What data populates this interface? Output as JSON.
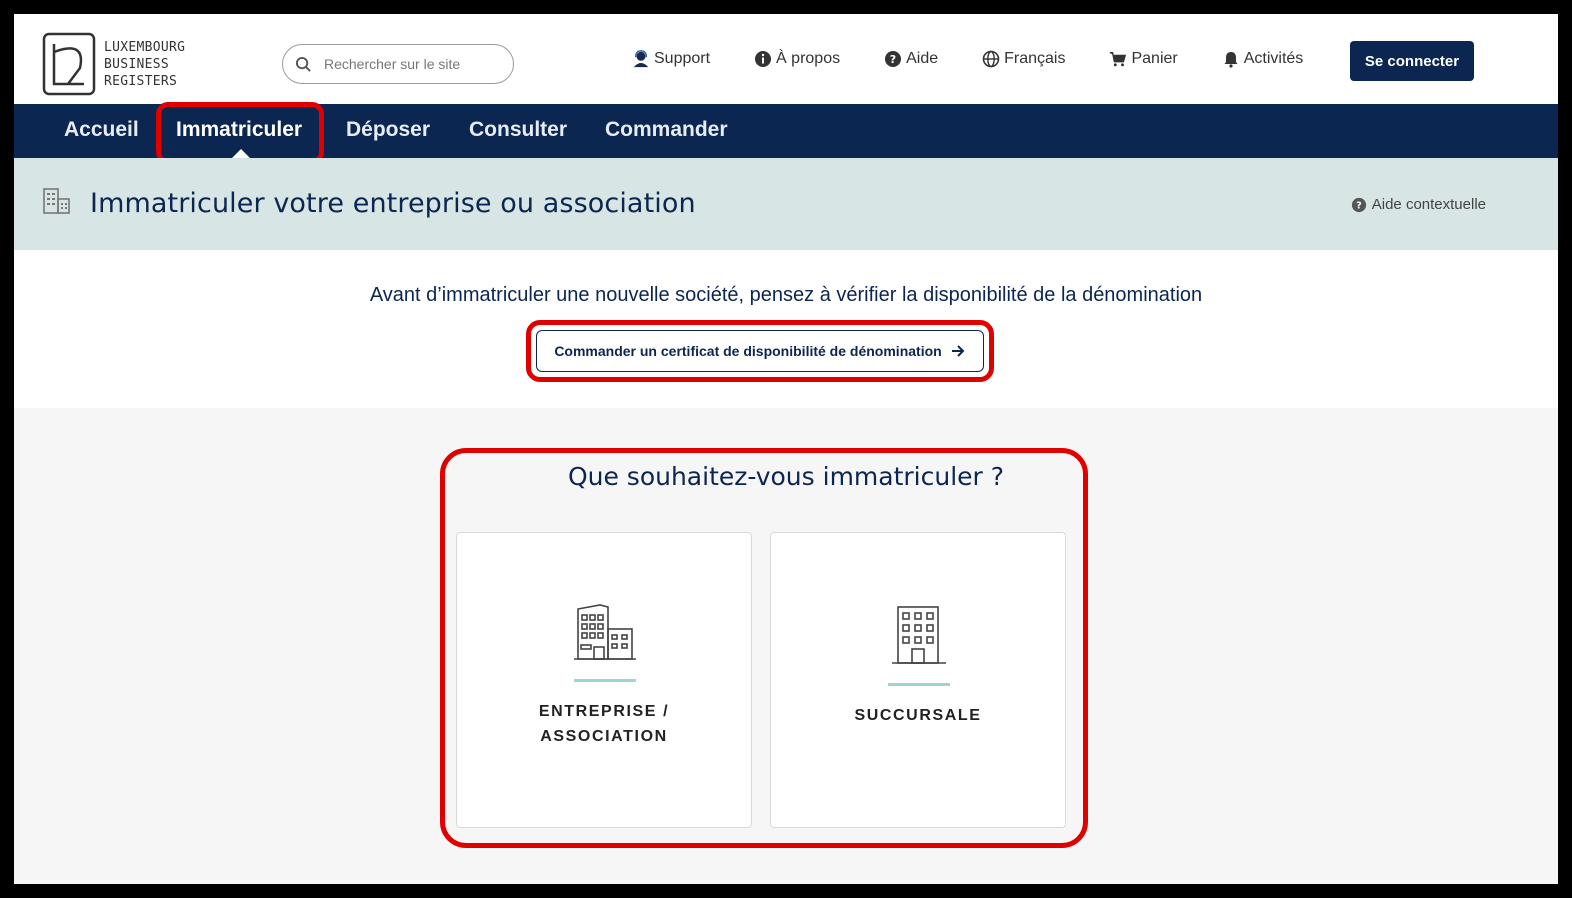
{
  "header": {
    "logo_lines": [
      "LUXEMBOURG",
      "BUSINESS",
      "REGISTERS"
    ],
    "search_placeholder": "Rechercher sur le site",
    "utilities": {
      "support": "Support",
      "about": "À propos",
      "help": "Aide",
      "language": "Français",
      "cart": "Panier",
      "activities": "Activités"
    },
    "login_label": "Se connecter"
  },
  "nav": {
    "items": [
      "Accueil",
      "Immatriculer",
      "Déposer",
      "Consulter",
      "Commander"
    ],
    "active": "Immatriculer"
  },
  "page": {
    "title": "Immatriculer votre entreprise ou association",
    "context_help": "Aide contextuelle"
  },
  "notice": {
    "text": "Avant d’immatriculer une nouvelle société, pensez à vérifier la disponibilité de la dénomination",
    "button_label": "Commander un certificat de disponibilité de dénomination"
  },
  "choice": {
    "title": "Que souhaitez-vous immatriculer ?",
    "cards": [
      {
        "label_line1": "ENTREPRISE /",
        "label_line2": "ASSOCIATION",
        "icon": "company-buildings-icon"
      },
      {
        "label_line1": "SUCCURSALE",
        "icon": "branch-building-icon"
      }
    ]
  },
  "colors": {
    "navy": "#0b2650",
    "header_band": "#d7e6e5",
    "highlight": "#e00000",
    "accent_bar": "#9fd3d4"
  }
}
